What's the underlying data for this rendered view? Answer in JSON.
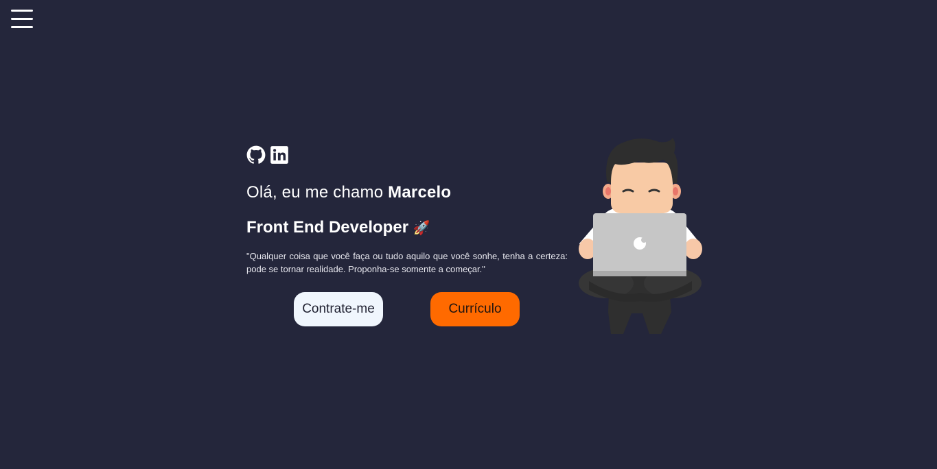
{
  "menu": {
    "icon": "hamburger-menu-icon"
  },
  "social": {
    "github_icon": "github-icon",
    "linkedin_icon": "linkedin-icon"
  },
  "hero": {
    "greeting_prefix": "Olá, eu me chamo ",
    "name": "Marcelo",
    "role": "Front End Developer",
    "role_emoji": "🚀",
    "quote": "\"Qualquer coisa que você faça ou tudo aquilo que você sonhe, tenha a certeza: pode se tornar realidade. Proponha-se somente a começar.\""
  },
  "buttons": {
    "hire_label": "Contrate-me",
    "cv_label": "Currículo"
  },
  "colors": {
    "background": "#24263b",
    "accent": "#ff6a00",
    "light_button": "#f0f6fd"
  }
}
